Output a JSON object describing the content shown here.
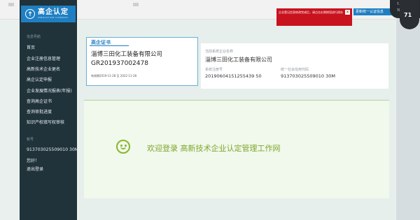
{
  "logo": {
    "main": "高企认定",
    "sub": "INNOVATION COMPANY"
  },
  "sidebar": {
    "nav_title": "信息导航",
    "items": [
      {
        "label": "首页"
      },
      {
        "label": "企业注册信息管理"
      },
      {
        "label": "高新技术企业更名"
      },
      {
        "label": "高企认定申报"
      },
      {
        "label": "企业发展情况报表(年报)"
      },
      {
        "label": "查询高企证书"
      },
      {
        "label": "查询审批进度"
      },
      {
        "label": "知识产权填写权审核"
      }
    ],
    "account_title": "帐号",
    "account_code": "913703025509010 30M",
    "hello": "您好！",
    "logout": "退出登录"
  },
  "certificate": {
    "heading": "高企证书",
    "company": "淄博三田化工装备有限公司",
    "number": "GR201937002478",
    "valid": "有效期2019-11-28 至 2022-11-28"
  },
  "info": {
    "company_label": "当前系统企业名称",
    "company_value": "淄博三田化工装备有限公司",
    "reg_label": "系统注册号",
    "reg_value": "20190604151255439 50",
    "credit_label": "统一社会信用代码",
    "credit_value": "913703025509010 30M"
  },
  "welcome": {
    "text": "欢迎登录 高新技术企业认定管理工作网"
  },
  "alert": {
    "text": "企业登记信息修改完成后，请点击右侧按钮进行保存",
    "close": "✕"
  },
  "upgrade_button": "更新统一认证信息",
  "speed": {
    "up": "7.6K/s",
    "down": "70.1K/s",
    "percent": "71"
  },
  "colors": {
    "brand": "#1f7fc2",
    "sidebar": "#20333a",
    "welcome": "#7ea72b",
    "alert": "#c8121e"
  }
}
